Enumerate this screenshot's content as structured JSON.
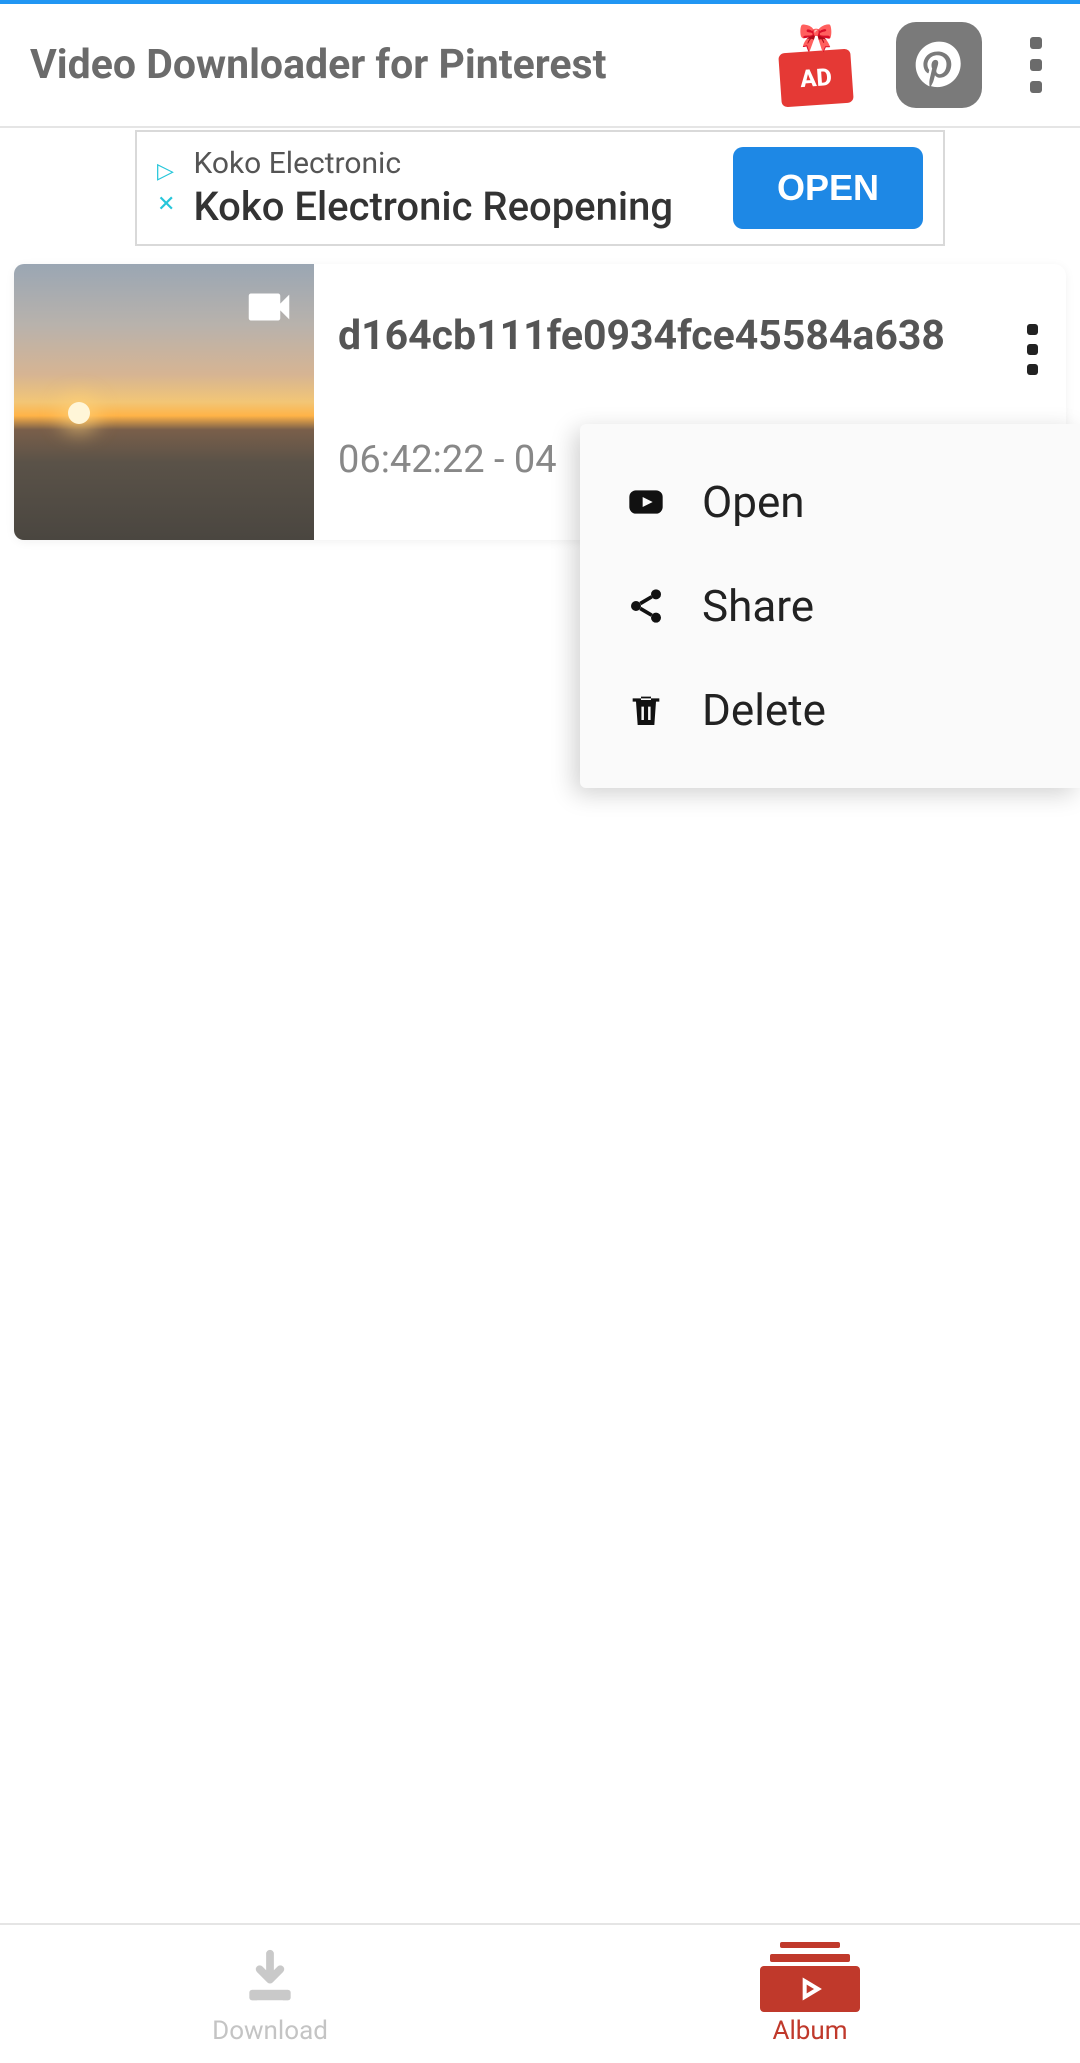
{
  "header": {
    "title": "Video Downloader for Pinterest",
    "ad_badge": "AD"
  },
  "ad": {
    "advertiser": "Koko Electronic",
    "headline": "Koko Electronic Reopening",
    "cta": "OPEN"
  },
  "video_item": {
    "filename": "d164cb111fe0934fce45584a638",
    "timestamp": "06:42:22 - 04"
  },
  "context_menu": {
    "open": "Open",
    "share": "Share",
    "delete": "Delete"
  },
  "bottom_nav": {
    "download": "Download",
    "album": "Album"
  }
}
